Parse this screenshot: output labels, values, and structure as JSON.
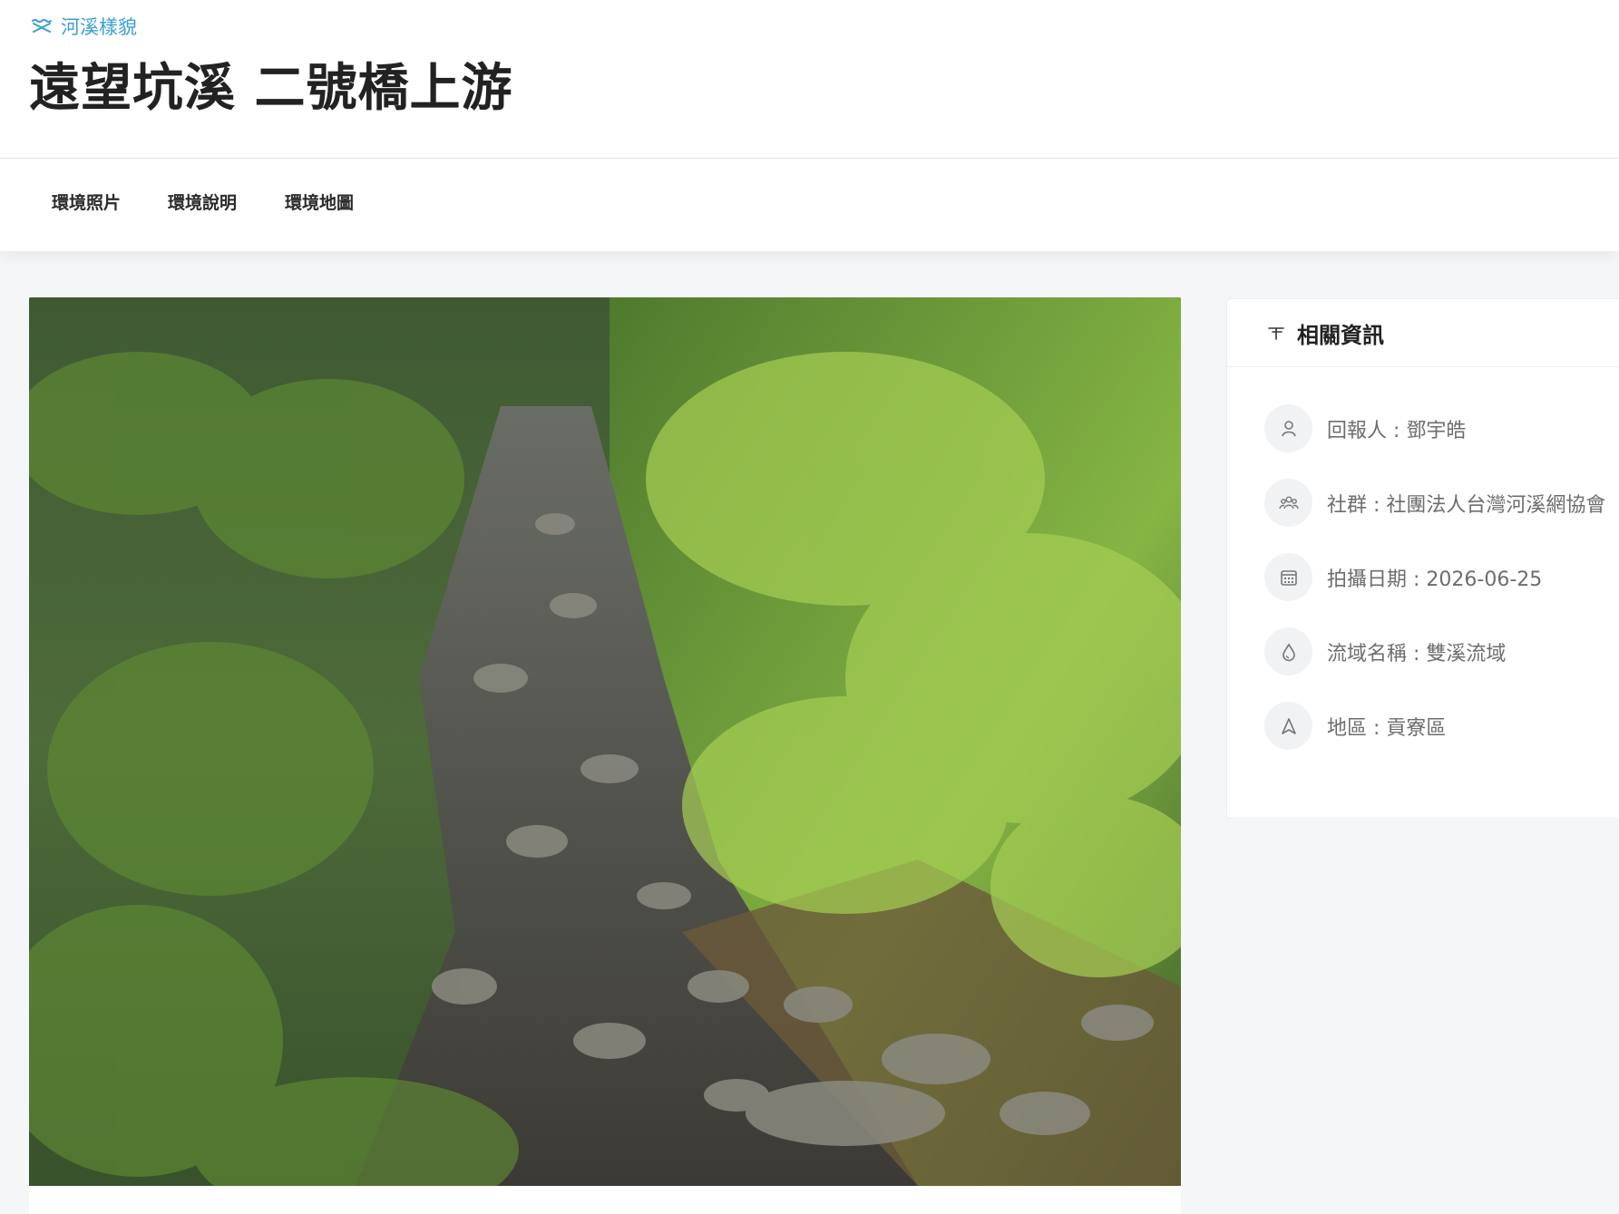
{
  "header": {
    "breadcrumb": "河溪樣貌",
    "title": "遠望坑溪 二號橋上游"
  },
  "tabs": [
    {
      "label": "環境照片"
    },
    {
      "label": "環境說明"
    },
    {
      "label": "環境地圖"
    }
  ],
  "photo": {
    "subject": "mountain stream with rocks and bamboo"
  },
  "info": {
    "title": "相關資訊",
    "rows": [
      {
        "icon": "user-icon",
        "text": "回報人 : 鄧宇皓"
      },
      {
        "icon": "group-icon",
        "text": "社群 : 社團法人台灣河溪網協會"
      },
      {
        "icon": "calendar-icon",
        "text": "拍攝日期 : 2026-06-25"
      },
      {
        "icon": "water-drop-icon",
        "text": "流域名稱 : 雙溪流域"
      },
      {
        "icon": "location-arrow-icon",
        "text": "地區 : 貢寮區"
      }
    ]
  },
  "colors": {
    "accent": "#3aa0cf",
    "background": "#f5f6f8",
    "text_dark": "#222222",
    "text_muted": "#6d6d6d"
  }
}
